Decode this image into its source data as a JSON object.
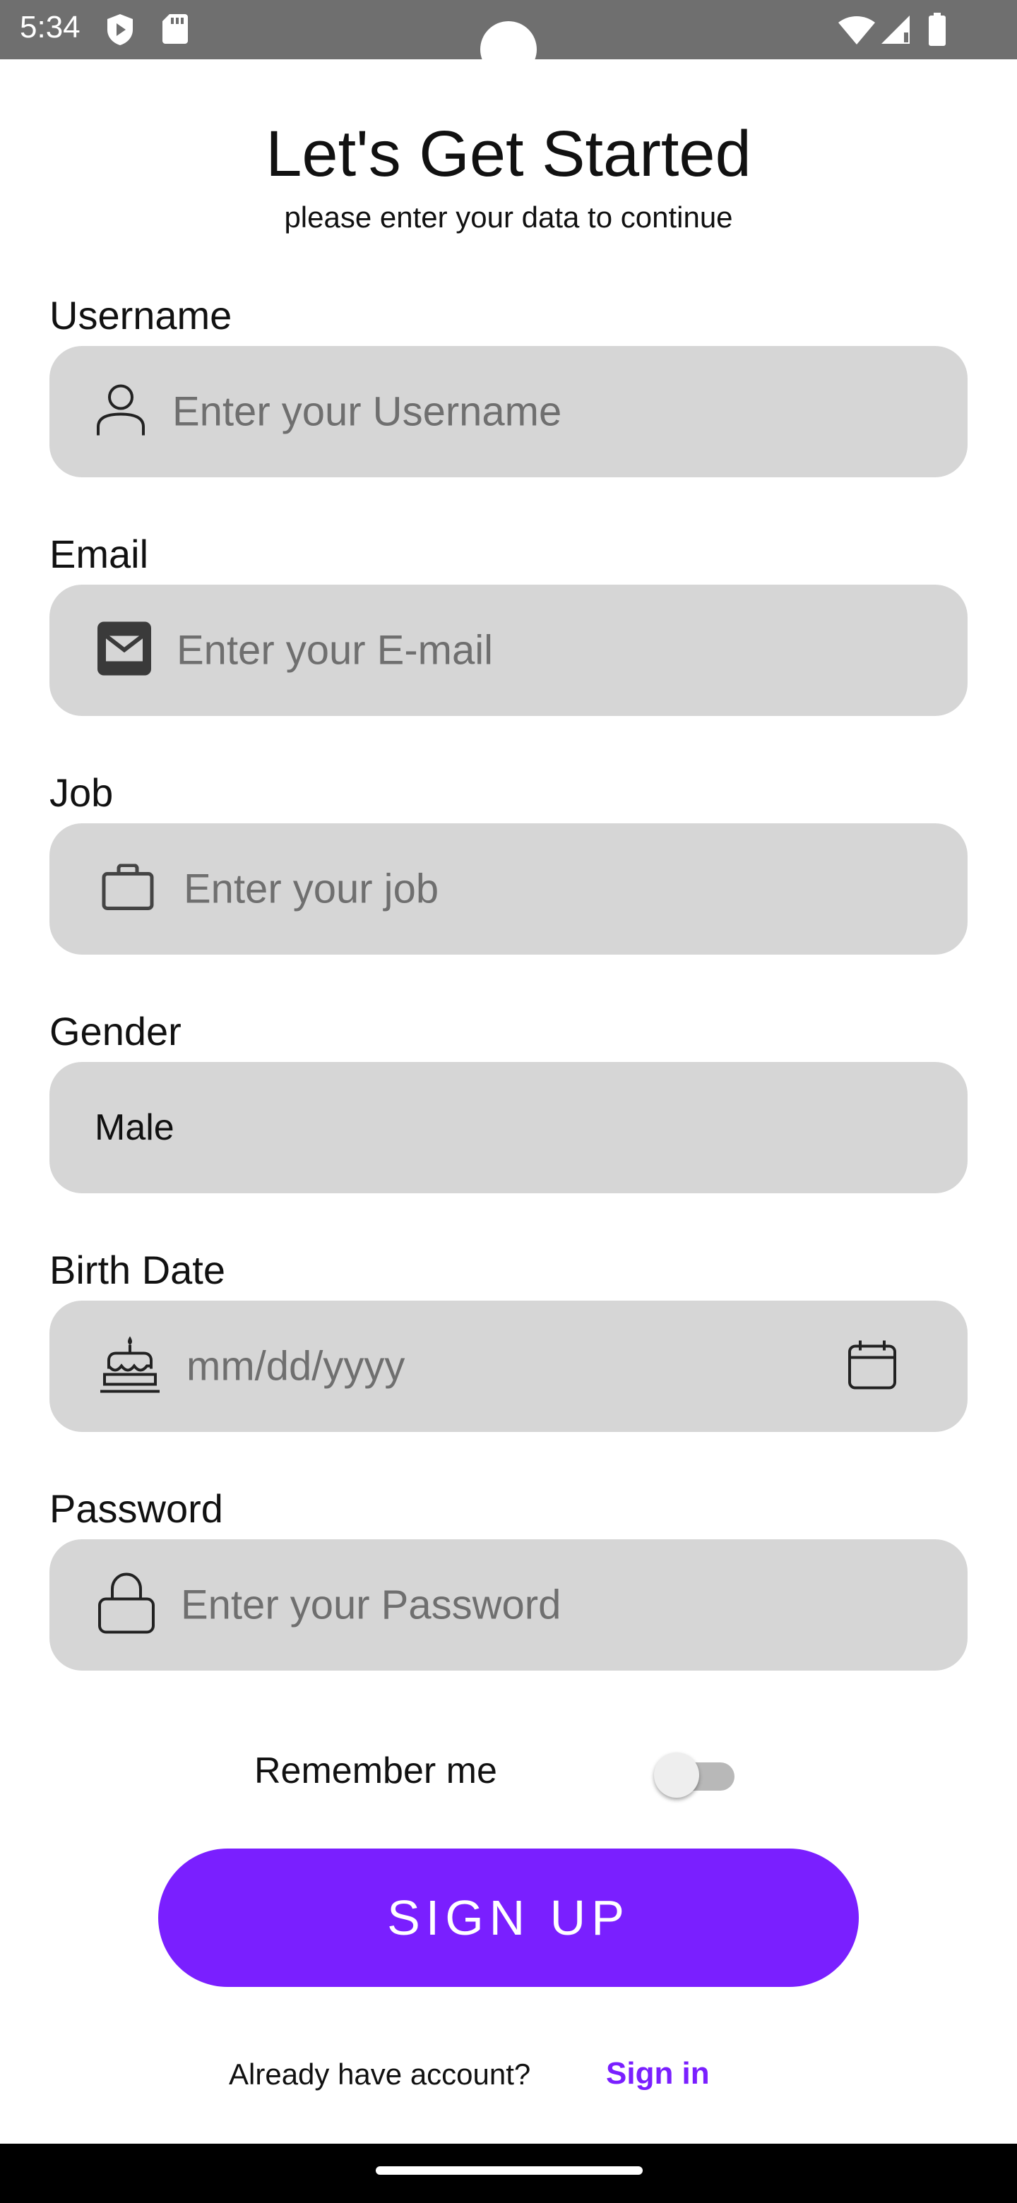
{
  "status_bar": {
    "time": "5:34",
    "icons": [
      "play-protect-icon",
      "sd-card-icon",
      "wifi-icon",
      "signal-icon",
      "battery-icon"
    ]
  },
  "header": {
    "title": "Let's Get Started",
    "subtitle": "please enter your data to continue"
  },
  "form": {
    "username": {
      "label": "Username",
      "placeholder": "Enter your Username",
      "icon": "person-icon"
    },
    "email": {
      "label": "Email",
      "placeholder": "Enter your E-mail",
      "icon": "envelope-icon"
    },
    "job": {
      "label": "Job",
      "placeholder": "Enter your job",
      "icon": "briefcase-icon"
    },
    "gender": {
      "label": "Gender",
      "value": "Male"
    },
    "birth_date": {
      "label": "Birth Date",
      "placeholder": "mm/dd/yyyy",
      "icon": "cake-icon",
      "trailing_icon": "calendar-icon"
    },
    "password": {
      "label": "Password",
      "placeholder": "Enter your Password",
      "icon": "lock-icon"
    }
  },
  "remember_me": {
    "label": "Remember me",
    "checked": false
  },
  "signup_button": {
    "label": "SIGN UP"
  },
  "footer": {
    "prompt": "Already have account?",
    "link": "Sign in"
  },
  "colors": {
    "accent": "#7a1fff",
    "field_background": "#d6d6d6",
    "placeholder_text": "#6f6f6f",
    "status_bar": "#6f6f6f"
  }
}
